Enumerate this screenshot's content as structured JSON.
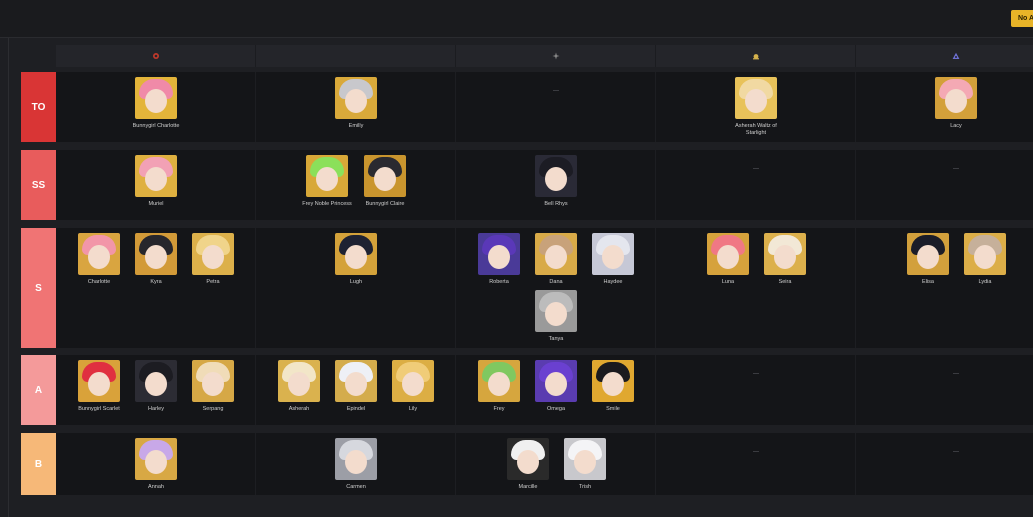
{
  "topbar": {
    "button_label": "No A"
  },
  "elements": [
    {
      "icon": "fire-element-icon",
      "color": "#c0392b"
    },
    {
      "icon": "water-element-icon",
      "color": "#3a7bd5"
    },
    {
      "icon": "wind-element-icon",
      "color": "#8a8a8a"
    },
    {
      "icon": "light-element-icon",
      "color": "#d4b24c"
    },
    {
      "icon": "dark-element-icon",
      "color": "#6c6fd1"
    }
  ],
  "tiers": [
    {
      "label": "TO",
      "color": "#d93535",
      "cells": [
        [
          {
            "name": "Bunnygirl Charlotte",
            "hair": "#f08aa8",
            "bg": "#e3b43a"
          }
        ],
        [
          {
            "name": "Emilly",
            "hair": "#c8c8cc",
            "bg": "#d9a93a"
          }
        ],
        [],
        [
          {
            "name": "Asherah Waltz of Starlight",
            "hair": "#f1d9a2",
            "bg": "#e8c25a"
          }
        ],
        [
          {
            "name": "Lacy",
            "hair": "#f4a9b4",
            "bg": "#d3a03a"
          }
        ]
      ]
    },
    {
      "label": "SS",
      "color": "#e85c5c",
      "cells": [
        [
          {
            "name": "Muriel",
            "hair": "#f2a1b5",
            "bg": "#dfb040"
          }
        ],
        [
          {
            "name": "Frey Noble Princess",
            "hair": "#8be05a",
            "bg": "#d8a838"
          },
          {
            "name": "Bunnygirl Claire",
            "hair": "#2a2a30",
            "bg": "#c9952e"
          }
        ],
        [
          {
            "name": "Bell Rhys",
            "hair": "#1c1c24",
            "bg": "#2a2a36"
          }
        ],
        [],
        []
      ]
    },
    {
      "label": "S",
      "color": "#f07474",
      "cells": [
        [
          {
            "name": "Charlotte",
            "hair": "#f296a8",
            "bg": "#d9a540"
          },
          {
            "name": "Kyra",
            "hair": "#26262c",
            "bg": "#d29a38"
          },
          {
            "name": "Petra",
            "hair": "#f0d48a",
            "bg": "#dcb04a"
          }
        ],
        [
          {
            "name": "Lugh",
            "hair": "#1e2232",
            "bg": "#d4a23a"
          }
        ],
        [
          {
            "name": "Roberta",
            "hair": "#5a38b8",
            "bg": "#4a3a98"
          },
          {
            "name": "Dana",
            "hair": "#c8a27a",
            "bg": "#d8aa48"
          },
          {
            "name": "Haydee",
            "hair": "#e4e6ee",
            "bg": "#c6c8d6"
          },
          {
            "name": "Tanya",
            "hair": "#bcbcbc",
            "bg": "#9a9a9a"
          }
        ],
        [
          {
            "name": "Luna",
            "hair": "#f07884",
            "bg": "#d6a23c"
          },
          {
            "name": "Seira",
            "hair": "#f2e8d6",
            "bg": "#dcb04c"
          }
        ],
        [
          {
            "name": "Elisa",
            "hair": "#1a1c28",
            "bg": "#d2a03c"
          },
          {
            "name": "Lydia",
            "hair": "#c6b09a",
            "bg": "#dcae48"
          }
        ]
      ]
    },
    {
      "label": "A",
      "color": "#f49a9a",
      "cells": [
        [
          {
            "name": "Bunnygirl Scarlet",
            "hair": "#e03040",
            "bg": "#d9a23a"
          },
          {
            "name": "Harley",
            "hair": "#1c1c22",
            "bg": "#2c2c34"
          },
          {
            "name": "Serpang",
            "hair": "#f0dcb8",
            "bg": "#d6a846"
          }
        ],
        [
          {
            "name": "Asherah",
            "hair": "#f2e6c8",
            "bg": "#dab24e"
          },
          {
            "name": "Epindel",
            "hair": "#eef0f6",
            "bg": "#d4ac4c"
          },
          {
            "name": "Lily",
            "hair": "#f0cc78",
            "bg": "#dcae44"
          }
        ],
        [
          {
            "name": "Frey",
            "hair": "#80c860",
            "bg": "#d6a63e"
          },
          {
            "name": "Omega",
            "hair": "#6a40d0",
            "bg": "#5a3cb0"
          },
          {
            "name": "Smile",
            "hair": "#1a1a1e",
            "bg": "#e0a830"
          }
        ],
        [],
        []
      ]
    },
    {
      "label": "B",
      "color": "#f6b878",
      "cells": [
        [
          {
            "name": "Annah",
            "hair": "#c8a8e8",
            "bg": "#d8a844"
          }
        ],
        [
          {
            "name": "Carmen",
            "hair": "#d6d8de",
            "bg": "#9c9ea6"
          }
        ],
        [
          {
            "name": "Marcille",
            "hair": "#f0f0f0",
            "bg": "#2a2a2a"
          },
          {
            "name": "Trish",
            "hair": "#f4f4f6",
            "bg": "#c8c8cc"
          }
        ],
        [],
        []
      ]
    }
  ]
}
